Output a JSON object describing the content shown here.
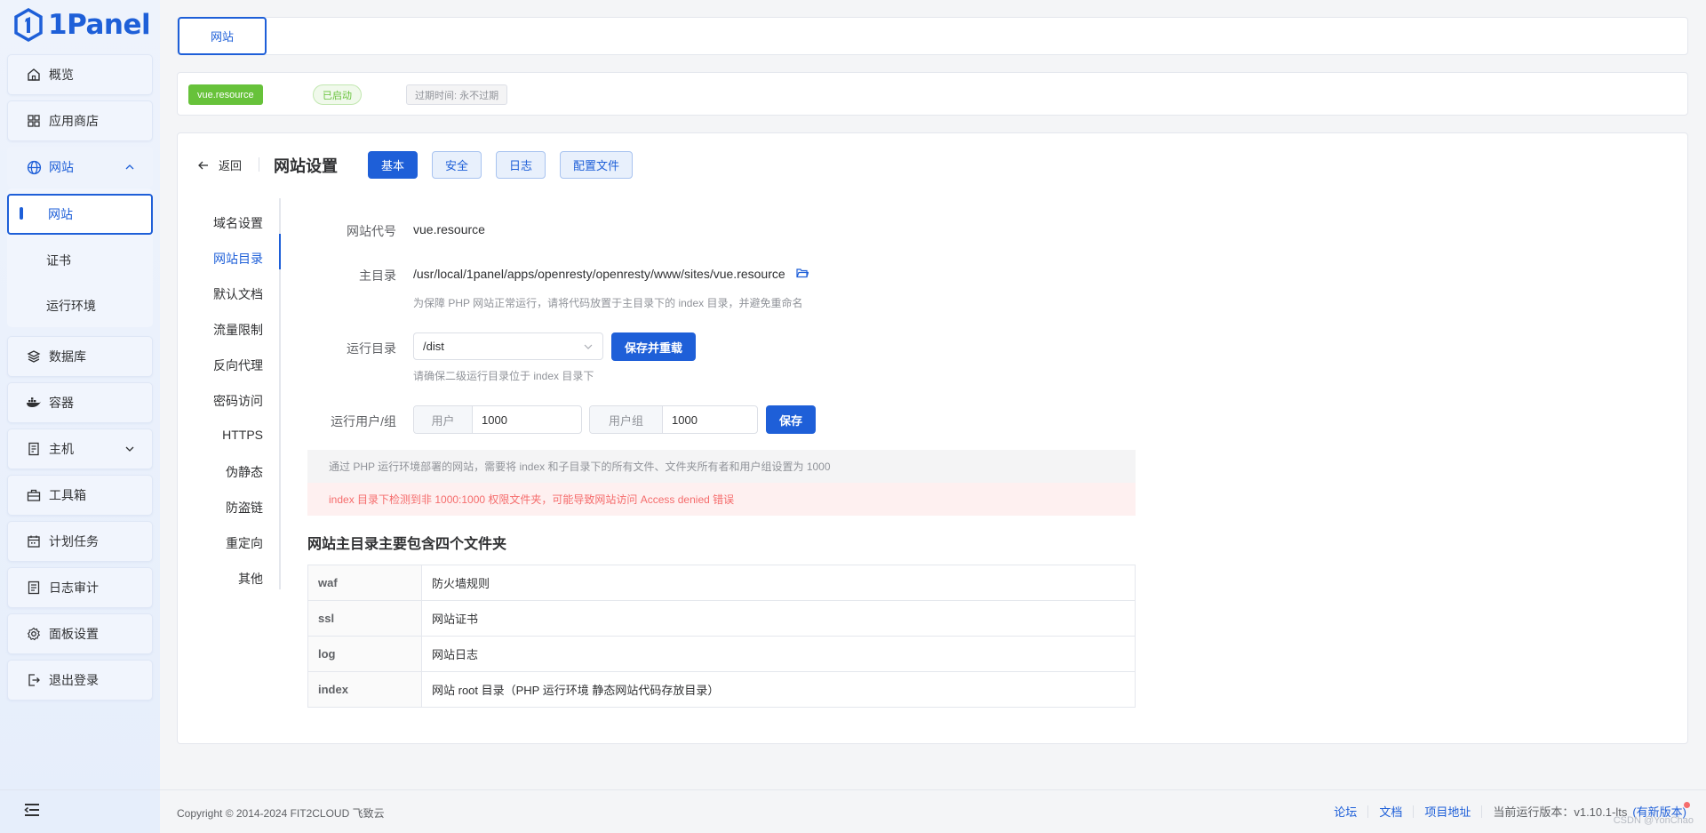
{
  "app": {
    "name": "1Panel"
  },
  "sidebar": {
    "items": [
      {
        "label": "概览",
        "icon": "home-icon"
      },
      {
        "label": "应用商店",
        "icon": "grid-icon"
      },
      {
        "label": "网站",
        "icon": "globe-icon"
      },
      {
        "label": "数据库",
        "icon": "layers-icon"
      },
      {
        "label": "容器",
        "icon": "docker-icon"
      },
      {
        "label": "主机",
        "icon": "server-icon"
      },
      {
        "label": "工具箱",
        "icon": "toolbox-icon"
      },
      {
        "label": "计划任务",
        "icon": "calendar-icon"
      },
      {
        "label": "日志审计",
        "icon": "log-icon"
      },
      {
        "label": "面板设置",
        "icon": "gear-icon"
      },
      {
        "label": "退出登录",
        "icon": "logout-icon"
      }
    ],
    "website_sub": [
      "网站",
      "证书",
      "运行环境"
    ]
  },
  "tabs": {
    "active": "网站"
  },
  "site_info": {
    "name": "vue.resource",
    "status": "已启动",
    "expire": "过期时间: 永不过期"
  },
  "settings": {
    "back": "返回",
    "title": "网站设置",
    "top_tabs": [
      "基本",
      "安全",
      "日志",
      "配置文件"
    ],
    "left_menu": [
      "域名设置",
      "网站目录",
      "默认文档",
      "流量限制",
      "反向代理",
      "密码访问",
      "HTTPS",
      "伪静态",
      "防盗链",
      "重定向",
      "其他"
    ],
    "form": {
      "code_label": "网站代号",
      "code_value": "vue.resource",
      "root_label": "主目录",
      "root_value": "/usr/local/1panel/apps/openresty/openresty/www/sites/vue.resource",
      "root_hint": "为保障 PHP 网站正常运行，请将代码放置于主目录下的 index 目录，并避免重命名",
      "run_dir_label": "运行目录",
      "run_dir_value": "/dist",
      "run_dir_button": "保存并重载",
      "run_dir_hint": "请确保二级运行目录位于 index 目录下",
      "user_label": "运行用户/组",
      "user_prefix": "用户",
      "user_value": "1000",
      "group_prefix": "用户组",
      "group_value": "1000",
      "save_button": "保存"
    },
    "alert_info": "通过 PHP 运行环境部署的网站，需要将 index 和子目录下的所有文件、文件夹所有者和用户组设置为 1000",
    "alert_error": "index 目录下检测到非 1000:1000 权限文件夹，可能导致网站访问 Access denied 错误",
    "folder_title": "网站主目录主要包含四个文件夹",
    "folders": [
      {
        "name": "waf",
        "desc": "防火墙规则"
      },
      {
        "name": "ssl",
        "desc": "网站证书"
      },
      {
        "name": "log",
        "desc": "网站日志"
      },
      {
        "name": "index",
        "desc": "网站 root 目录（PHP 运行环境 静态网站代码存放目录）"
      }
    ]
  },
  "footer": {
    "copyright": "Copyright © 2014-2024 FIT2CLOUD 飞致云",
    "links": [
      "论坛",
      "文档",
      "项目地址"
    ],
    "version": "当前运行版本：v1.10.1-lts",
    "new_version": "(有新版本)",
    "watermark": "CSDN @YonChao"
  },
  "colors": {
    "primary": "#1e5fd8",
    "success": "#67c23a",
    "danger": "#f56c6c"
  }
}
